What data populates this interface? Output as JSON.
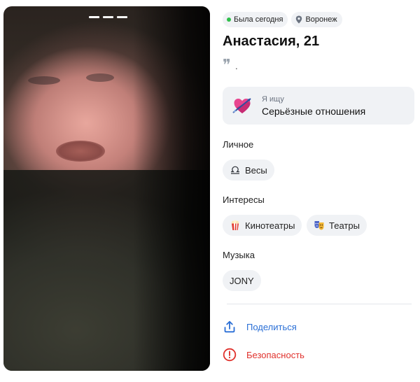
{
  "photo": {
    "alt_icon": "profile-photo",
    "indicator_count": 3
  },
  "status": {
    "online_label": "Была сегодня",
    "online_color": "#2fbf4a",
    "city": "Воронеж"
  },
  "profile": {
    "name_age": "Анастасия, 21",
    "quote_icon": "quote-icon",
    "quote_text": "."
  },
  "looking_for": {
    "label": "Я ищу",
    "value": "Серьёзные отношения",
    "icon": "heart-arrow-icon"
  },
  "personal": {
    "title": "Личное",
    "items": [
      {
        "icon": "libra-icon",
        "label": "Весы"
      }
    ]
  },
  "interests": {
    "title": "Интересы",
    "items": [
      {
        "icon": "popcorn-icon",
        "label": "Кинотеатры"
      },
      {
        "icon": "theater-masks-icon",
        "label": "Театры"
      }
    ]
  },
  "music": {
    "title": "Музыка",
    "items": [
      {
        "label": "JONY"
      }
    ]
  },
  "actions": {
    "share_label": "Поделиться",
    "safety_label": "Безопасность",
    "share_color": "#2a6fd6",
    "safety_color": "#e0322d"
  }
}
